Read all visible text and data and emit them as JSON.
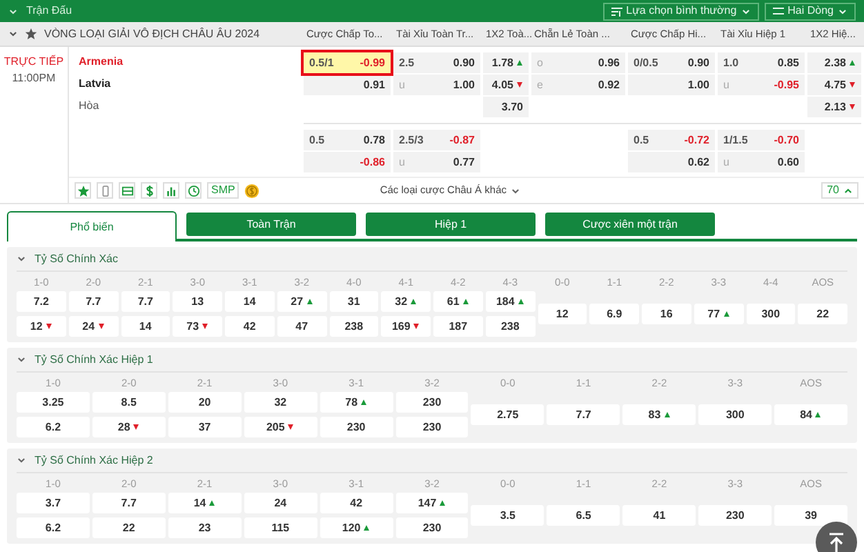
{
  "top_bar": {
    "title": "Trận Đấu",
    "buttons": [
      "Lựa chọn bình thường",
      "Hai Dòng"
    ]
  },
  "league": {
    "name": "VÒNG LOẠI GIẢI VÔ ĐỊCH CHÂU ÂU 2024",
    "favorite": false
  },
  "market_columns": [
    {
      "title": "Cược Chấp To...",
      "blocks": [
        [
          {
            "label": "0.5/1",
            "odds": "-0.99",
            "negative": true,
            "highlighted": true
          },
          {
            "odds": "0.91"
          }
        ],
        [
          {
            "label": "0.5",
            "odds": "0.78"
          },
          {
            "odds": "-0.86",
            "negative": true
          }
        ]
      ]
    },
    {
      "title": "Tài Xỉu Toàn Tr...",
      "blocks": [
        [
          {
            "label": "2.5",
            "odds": "0.90"
          },
          {
            "label": "u",
            "odds": "1.00"
          }
        ],
        [
          {
            "label": "2.5/3",
            "odds": "-0.87",
            "negative": true
          },
          {
            "label": "u",
            "odds": "0.77"
          }
        ]
      ]
    },
    {
      "title": "1X2 Toà...",
      "blocks": [
        [
          {
            "odds": "1.78",
            "rising": true
          },
          {
            "odds": "4.05",
            "rising": false
          },
          {
            "odds": "3.70"
          }
        ]
      ]
    },
    {
      "title": "Chẵn Lẻ Toàn ...",
      "blocks": [
        [
          {
            "label": "o",
            "odds": "0.96"
          },
          {
            "label": "e",
            "odds": "0.92"
          }
        ]
      ]
    },
    {
      "title": "Cược Chấp Hi...",
      "blocks": [
        [
          {
            "label": "0/0.5",
            "odds": "0.90"
          },
          {
            "odds": "1.00"
          }
        ],
        [
          {
            "label": "0.5",
            "odds": "-0.72",
            "negative": true
          },
          {
            "odds": "0.62"
          }
        ]
      ]
    },
    {
      "title": "Tài Xỉu Hiệp 1",
      "blocks": [
        [
          {
            "label": "1.0",
            "odds": "0.85"
          },
          {
            "label": "u",
            "odds": "-0.95",
            "negative": true
          }
        ],
        [
          {
            "label": "1/1.5",
            "odds": "-0.70",
            "negative": true
          },
          {
            "label": "u",
            "odds": "0.60"
          }
        ]
      ]
    },
    {
      "title": "1X2 Hiệ...",
      "blocks": [
        [
          {
            "odds": "2.38",
            "rising": true
          },
          {
            "odds": "4.75",
            "rising": false
          },
          {
            "odds": "2.13",
            "rising": false
          }
        ]
      ]
    }
  ],
  "match": {
    "status": "TRỰC TIẾP",
    "time": "11:00PM",
    "home": "Armenia",
    "away": "Latvia",
    "draw": "Hòa",
    "favorite": true,
    "smp": "SMP",
    "more_bets": "Các loại cược Châu Á khác",
    "count": "70"
  },
  "tabs": [
    {
      "label": "Phổ biến",
      "selected": true
    },
    {
      "label": "Toàn Trận",
      "selected": false
    },
    {
      "label": "Hiệp 1",
      "selected": false
    },
    {
      "label": "Cược xiên một trận",
      "selected": false
    }
  ],
  "sections": [
    {
      "title": "Tỷ Số Chính Xác",
      "expanded": true,
      "scores": [
        {
          "label": "1-0",
          "values": [
            {
              "odds": "7.2"
            },
            {
              "odds": "12",
              "rising": false
            }
          ]
        },
        {
          "label": "2-0",
          "values": [
            {
              "odds": "7.7"
            },
            {
              "odds": "24",
              "rising": false
            }
          ]
        },
        {
          "label": "2-1",
          "values": [
            {
              "odds": "7.7"
            },
            {
              "odds": "14"
            }
          ]
        },
        {
          "label": "3-0",
          "values": [
            {
              "odds": "13"
            },
            {
              "odds": "73",
              "rising": false
            }
          ]
        },
        {
          "label": "3-1",
          "values": [
            {
              "odds": "14"
            },
            {
              "odds": "42"
            }
          ]
        },
        {
          "label": "3-2",
          "values": [
            {
              "odds": "27",
              "rising": true
            },
            {
              "odds": "47"
            }
          ]
        },
        {
          "label": "4-0",
          "values": [
            {
              "odds": "31"
            },
            {
              "odds": "238"
            }
          ]
        },
        {
          "label": "4-1",
          "values": [
            {
              "odds": "32",
              "rising": true
            },
            {
              "odds": "169",
              "rising": false
            }
          ]
        },
        {
          "label": "4-2",
          "values": [
            {
              "odds": "61",
              "rising": true
            },
            {
              "odds": "187"
            }
          ]
        },
        {
          "label": "4-3",
          "values": [
            {
              "odds": "184",
              "rising": true
            },
            {
              "odds": "238"
            }
          ]
        },
        {
          "label": "0-0",
          "values": [
            {
              "odds": "12"
            }
          ]
        },
        {
          "label": "1-1",
          "values": [
            {
              "odds": "6.9"
            }
          ]
        },
        {
          "label": "2-2",
          "values": [
            {
              "odds": "16"
            }
          ]
        },
        {
          "label": "3-3",
          "values": [
            {
              "odds": "77",
              "rising": true
            }
          ]
        },
        {
          "label": "4-4",
          "values": [
            {
              "odds": "300"
            }
          ]
        },
        {
          "label": "AOS",
          "values": [
            {
              "odds": "22"
            }
          ]
        }
      ]
    },
    {
      "title": "Tỷ Số Chính Xác Hiệp 1",
      "expanded": true,
      "scores": [
        {
          "label": "1-0",
          "values": [
            {
              "odds": "3.25"
            },
            {
              "odds": "6.2"
            }
          ]
        },
        {
          "label": "2-0",
          "values": [
            {
              "odds": "8.5"
            },
            {
              "odds": "28",
              "rising": false
            }
          ]
        },
        {
          "label": "2-1",
          "values": [
            {
              "odds": "20"
            },
            {
              "odds": "37"
            }
          ]
        },
        {
          "label": "3-0",
          "values": [
            {
              "odds": "32"
            },
            {
              "odds": "205",
              "rising": false
            }
          ]
        },
        {
          "label": "3-1",
          "values": [
            {
              "odds": "78",
              "rising": true
            },
            {
              "odds": "230"
            }
          ]
        },
        {
          "label": "3-2",
          "values": [
            {
              "odds": "230"
            },
            {
              "odds": "230"
            }
          ]
        },
        {
          "label": "0-0",
          "values": [
            {
              "odds": "2.75"
            }
          ]
        },
        {
          "label": "1-1",
          "values": [
            {
              "odds": "7.7"
            }
          ]
        },
        {
          "label": "2-2",
          "values": [
            {
              "odds": "83",
              "rising": true
            }
          ]
        },
        {
          "label": "3-3",
          "values": [
            {
              "odds": "300"
            }
          ]
        },
        {
          "label": "AOS",
          "values": [
            {
              "odds": "84",
              "rising": true
            }
          ]
        }
      ]
    },
    {
      "title": "Tỷ Số Chính Xác Hiệp 2",
      "expanded": true,
      "scores": [
        {
          "label": "1-0",
          "values": [
            {
              "odds": "3.7"
            },
            {
              "odds": "6.2"
            }
          ]
        },
        {
          "label": "2-0",
          "values": [
            {
              "odds": "7.7"
            },
            {
              "odds": "22"
            }
          ]
        },
        {
          "label": "2-1",
          "values": [
            {
              "odds": "14",
              "rising": true
            },
            {
              "odds": "23"
            }
          ]
        },
        {
          "label": "3-0",
          "values": [
            {
              "odds": "24"
            },
            {
              "odds": "115"
            }
          ]
        },
        {
          "label": "3-1",
          "values": [
            {
              "odds": "42"
            },
            {
              "odds": "120",
              "rising": true
            }
          ]
        },
        {
          "label": "3-2",
          "values": [
            {
              "odds": "147",
              "rising": true
            },
            {
              "odds": "230"
            }
          ]
        },
        {
          "label": "0-0",
          "values": [
            {
              "odds": "3.5"
            }
          ]
        },
        {
          "label": "1-1",
          "values": [
            {
              "odds": "6.5"
            }
          ]
        },
        {
          "label": "2-2",
          "values": [
            {
              "odds": "41"
            }
          ]
        },
        {
          "label": "3-3",
          "values": [
            {
              "odds": "230"
            }
          ]
        },
        {
          "label": "AOS",
          "values": [
            {
              "odds": "39"
            }
          ]
        }
      ]
    }
  ]
}
